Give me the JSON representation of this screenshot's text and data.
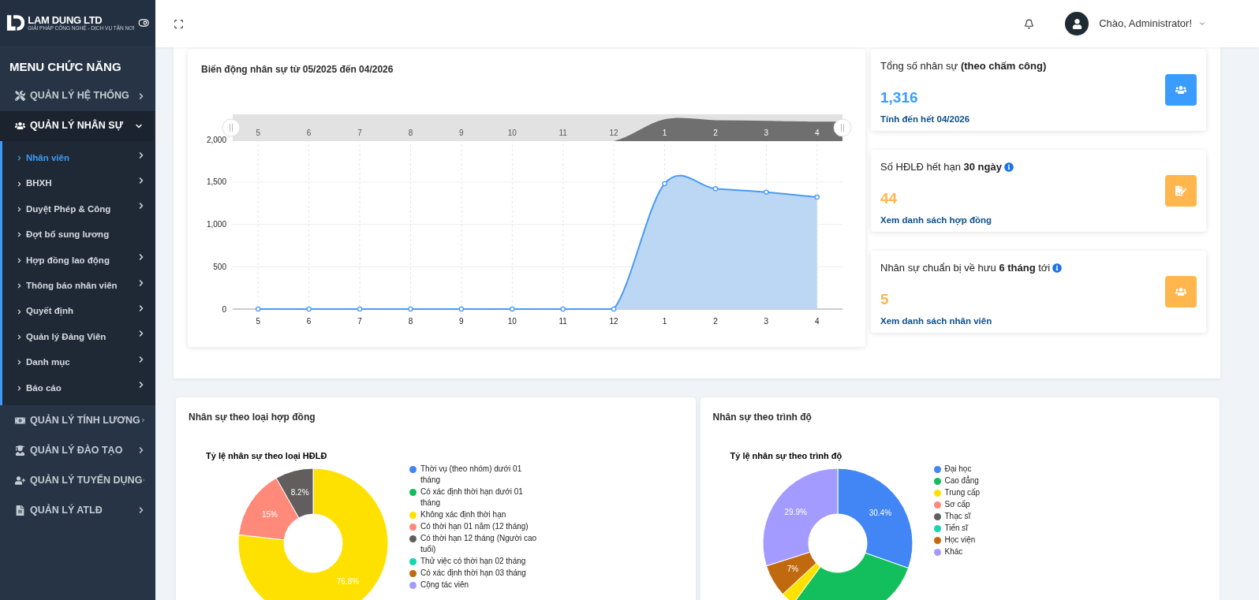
{
  "sidebar": {
    "logo": {
      "name": "LAM DUNG LTD",
      "tagline": "GIẢI PHÁP CÔNG NGHỆ - DỊCH VỤ TẬN NƠI"
    },
    "menu_title": "MENU CHỨC NĂNG",
    "groups": [
      {
        "label": "QUẢN LÝ HỆ THỐNG",
        "expanded": false
      },
      {
        "label": "QUẢN LÝ NHÂN SỰ",
        "expanded": true,
        "children": [
          {
            "label": "Nhân viên",
            "selected": true,
            "has_submenu": true
          },
          {
            "label": "BHXH",
            "selected": false,
            "has_submenu": true
          },
          {
            "label": "Duyệt Phép & Công",
            "selected": false,
            "has_submenu": true
          },
          {
            "label": "Đợt bổ sung lương",
            "selected": false,
            "has_submenu": false
          },
          {
            "label": "Hợp đồng lao động",
            "selected": false,
            "has_submenu": true
          },
          {
            "label": "Thông báo nhân viên",
            "selected": false,
            "has_submenu": true
          },
          {
            "label": "Quyết định",
            "selected": false,
            "has_submenu": true
          },
          {
            "label": "Quản lý Đảng Viên",
            "selected": false,
            "has_submenu": true
          },
          {
            "label": "Danh mục",
            "selected": false,
            "has_submenu": true
          },
          {
            "label": "Báo cáo",
            "selected": false,
            "has_submenu": true
          }
        ]
      },
      {
        "label": "QUẢN LÝ TÍNH LƯƠNG",
        "expanded": false
      },
      {
        "label": "QUẢN LÝ ĐÀO TẠO",
        "expanded": false
      },
      {
        "label": "QUẢN LÝ TUYỂN DỤNG",
        "expanded": false
      },
      {
        "label": "QUẢN LÝ ATLĐ",
        "expanded": false
      }
    ]
  },
  "header": {
    "greeting": "Chào, Administrator!"
  },
  "trend": {
    "title": "Biến động nhân sự từ 05/2025 đến 04/2026",
    "navigator_labels": [
      "5",
      "6",
      "7",
      "8",
      "9",
      "10",
      "11",
      "12",
      "1",
      "2",
      "3",
      "4"
    ],
    "chart_data": {
      "type": "area",
      "categories": [
        "5",
        "6",
        "7",
        "8",
        "9",
        "10",
        "11",
        "12",
        "1",
        "2",
        "3",
        "4"
      ],
      "grid": true,
      "series": [
        {
          "color": "#4a9af5",
          "values": [
            0,
            0,
            0,
            0,
            0,
            0,
            0,
            0,
            1480,
            1420,
            1380,
            1320
          ]
        }
      ],
      "ylim": [
        0,
        2000
      ],
      "yticks": [
        {
          "value": 0,
          "label": "0"
        },
        {
          "value": 500,
          "label": "500"
        },
        {
          "value": 1000,
          "label": "1,000"
        },
        {
          "value": 1500,
          "label": "1,500"
        },
        {
          "value": 2000,
          "label": "2,000"
        }
      ]
    }
  },
  "stats": [
    {
      "title": "Tổng số nhân sự **(theo chấm công)**",
      "info": false,
      "value": "1,316",
      "color": "#3b9cff",
      "footer": "Tính đến hết **04/2026**"
    },
    {
      "title": "Số HĐLĐ hết hạn **30 ngày**",
      "info": true,
      "value": "44",
      "color": "#ffb64d",
      "footer": "Xem danh sách hợp đồng"
    },
    {
      "title": "Nhân sự chuẩn bị về hưu **6 tháng** tới",
      "info": true,
      "value": "5",
      "color": "#ffb64d",
      "footer": "Xem danh sách nhân viên"
    }
  ],
  "panels": [
    {
      "title": "Nhân sự theo loại hợp đồng",
      "chart_data": {
        "type": "donut",
        "title": "Tỷ lệ nhân sự theo loại HĐLĐ",
        "categories": [
          "Thời vụ (theo nhóm) dưới 01 tháng",
          "Có xác định thời hạn dưới 01 tháng",
          "Không xác định thời hạn",
          "Có thời hạn 01 năm (12 tháng)",
          "Có thời hạn 12 tháng (Người cao tuổi)",
          "Thử việc có thời hạn 02 tháng",
          "Có xác định thời hạn 03 tháng",
          "Cộng tác viên"
        ],
        "values": [
          0,
          0,
          76.8,
          15,
          8.2,
          0,
          0,
          0
        ],
        "legend": true,
        "colors": [
          "#4285f4",
          "#12bf5c",
          "#ffe100",
          "#ff8a7a",
          "#625e5e",
          "#14d7b0",
          "#c1690e",
          "#a39bff"
        ],
        "value_labels": [
          null,
          null,
          "76.8%",
          "15%",
          "8.2%",
          null,
          null,
          null
        ]
      }
    },
    {
      "title": "Nhân sự theo trình độ",
      "chart_data": {
        "type": "donut",
        "title": "Tỷ lệ nhân sự theo trình độ",
        "categories": [
          "Đại học",
          "Cao đẳng",
          "Trung cấp",
          "Sơ cấp",
          "Thạc sĩ",
          "Tiến sĩ",
          "Học viện",
          "Khác"
        ],
        "values": [
          30.4,
          29.7,
          3,
          0,
          0,
          0,
          7,
          29.9
        ],
        "legend": true,
        "colors": [
          "#4285f4",
          "#12bf5c",
          "#ffe100",
          "#ff8a7a",
          "#625e5e",
          "#14d7b0",
          "#c1690e",
          "#a39bff"
        ],
        "value_labels": [
          "30.4%",
          null,
          null,
          null,
          null,
          null,
          "7%",
          "29.9%"
        ]
      }
    }
  ]
}
